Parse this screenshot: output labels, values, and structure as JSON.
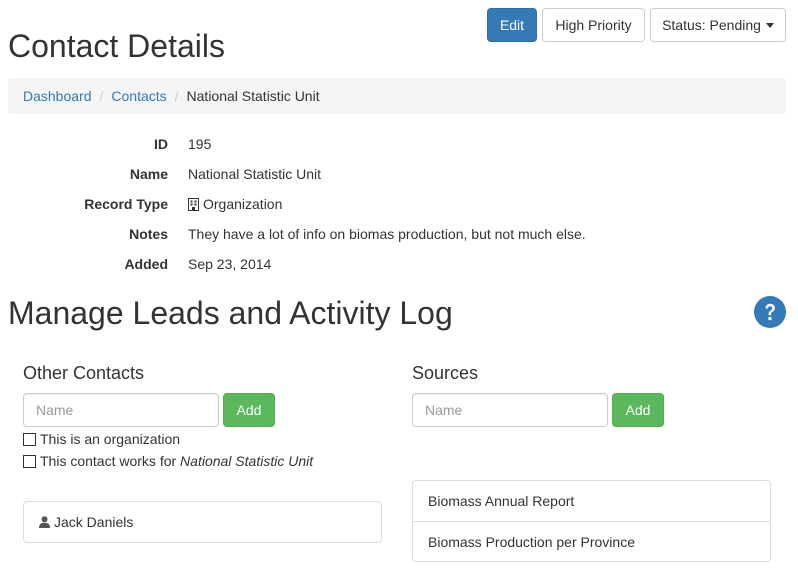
{
  "header": {
    "title": "Contact Details",
    "edit_label": "Edit",
    "priority_label": "High Priority",
    "status_label": "Status: Pending"
  },
  "breadcrumb": {
    "items": [
      "Dashboard",
      "Contacts",
      "National Statistic Unit"
    ]
  },
  "details": {
    "id_label": "ID",
    "id_value": "195",
    "name_label": "Name",
    "name_value": "National Statistic Unit",
    "type_label": "Record Type",
    "type_value": "Organization",
    "type_icon": "building-icon",
    "notes_label": "Notes",
    "notes_value": "They have a lot of info on biomas production, but not much else.",
    "added_label": "Added",
    "added_value": "Sep 23, 2014"
  },
  "leads": {
    "title": "Manage Leads and Activity Log",
    "help_icon": "question-circle-icon",
    "help_color": "#337ab7"
  },
  "other_contacts": {
    "heading": "Other Contacts",
    "input_placeholder": "Name",
    "add_label": "Add",
    "org_checkbox_label": "This is an organization",
    "works_for_prefix": "This contact works for ",
    "works_for_org": "National Statistic Unit",
    "contacts": [
      {
        "name": "Jack Daniels",
        "icon": "user-icon"
      }
    ]
  },
  "sources": {
    "heading": "Sources",
    "input_placeholder": "Name",
    "add_label": "Add",
    "items": [
      "Biomass Annual Report",
      "Biomass Production per Province"
    ]
  },
  "colors": {
    "primary": "#337ab7",
    "success": "#5cb85c",
    "breadcrumb_bg": "#f5f5f5"
  }
}
